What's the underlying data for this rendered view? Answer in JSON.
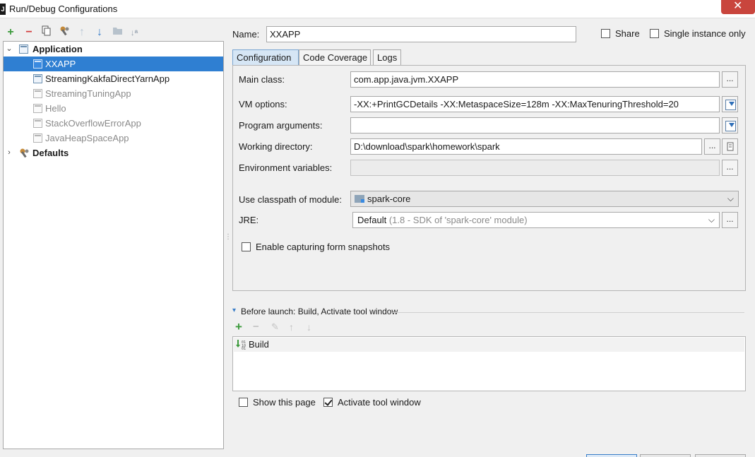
{
  "window": {
    "title": "Run/Debug Configurations",
    "app_icon": "J",
    "close_glyph": "✕"
  },
  "toolbar": {
    "add": "+",
    "remove": "−",
    "copy": "copy-icon",
    "edit_defaults": "wrench-icon",
    "move_up": "↑",
    "move_down": "↓",
    "folder": "folder-icon",
    "sort": "↓ᵃ"
  },
  "tree": {
    "application": {
      "label": "Application",
      "caret": "⌄"
    },
    "items": [
      {
        "label": "XXAPP",
        "selected": true
      },
      {
        "label": "StreamingKakfaDirectYarnApp",
        "selected": false
      },
      {
        "label": "StreamingTuningApp",
        "selected": false
      },
      {
        "label": "Hello",
        "selected": false
      },
      {
        "label": "StackOverflowErrorApp",
        "selected": false
      },
      {
        "label": "JavaHeapSpaceApp",
        "selected": false
      }
    ],
    "defaults": {
      "label": "Defaults",
      "caret": "›"
    }
  },
  "header": {
    "name_label": "Name:",
    "name_value": "XXAPP",
    "share_label": "Share",
    "single_instance_label": "Single instance only"
  },
  "tabs": [
    {
      "label": "Configuration",
      "active": true
    },
    {
      "label": "Code Coverage",
      "active": false
    },
    {
      "label": "Logs",
      "active": false
    }
  ],
  "config": {
    "main_class_label": "Main class:",
    "main_class_value": "com.app.java.jvm.XXAPP",
    "vm_options_label": "VM options:",
    "vm_options_value": "-XX:+PrintGCDetails -XX:MetaspaceSize=128m -XX:MaxTenuringThreshold=20",
    "program_args_label": "Program arguments:",
    "program_args_value": "",
    "working_dir_label": "Working directory:",
    "working_dir_value": "D:\\download\\spark\\homework\\spark",
    "env_vars_label": "Environment variables:",
    "env_vars_value": "",
    "classpath_label": "Use classpath of module:",
    "classpath_value": "spark-core",
    "jre_label": "JRE:",
    "jre_value": "Default",
    "jre_detail": "(1.8 - SDK of 'spark-core' module)",
    "snapshots_label": "Enable capturing form snapshots",
    "ellipsis": "..."
  },
  "before_launch": {
    "title": "Before launch: Build, Activate tool window",
    "toggle": "▾",
    "add": "+",
    "remove": "−",
    "edit": "✎",
    "up": "↑",
    "down": "↓",
    "items": [
      {
        "label": "Build"
      }
    ]
  },
  "footer": {
    "show_page_label": "Show this page",
    "show_page_checked": false,
    "activate_tool_label": "Activate tool window",
    "activate_tool_checked": true
  },
  "colors": {
    "selection": "#2f7fd2",
    "add_green": "#3c9a3c",
    "remove_red": "#d23c3c",
    "arrow_blue": "#3a7ec8"
  }
}
